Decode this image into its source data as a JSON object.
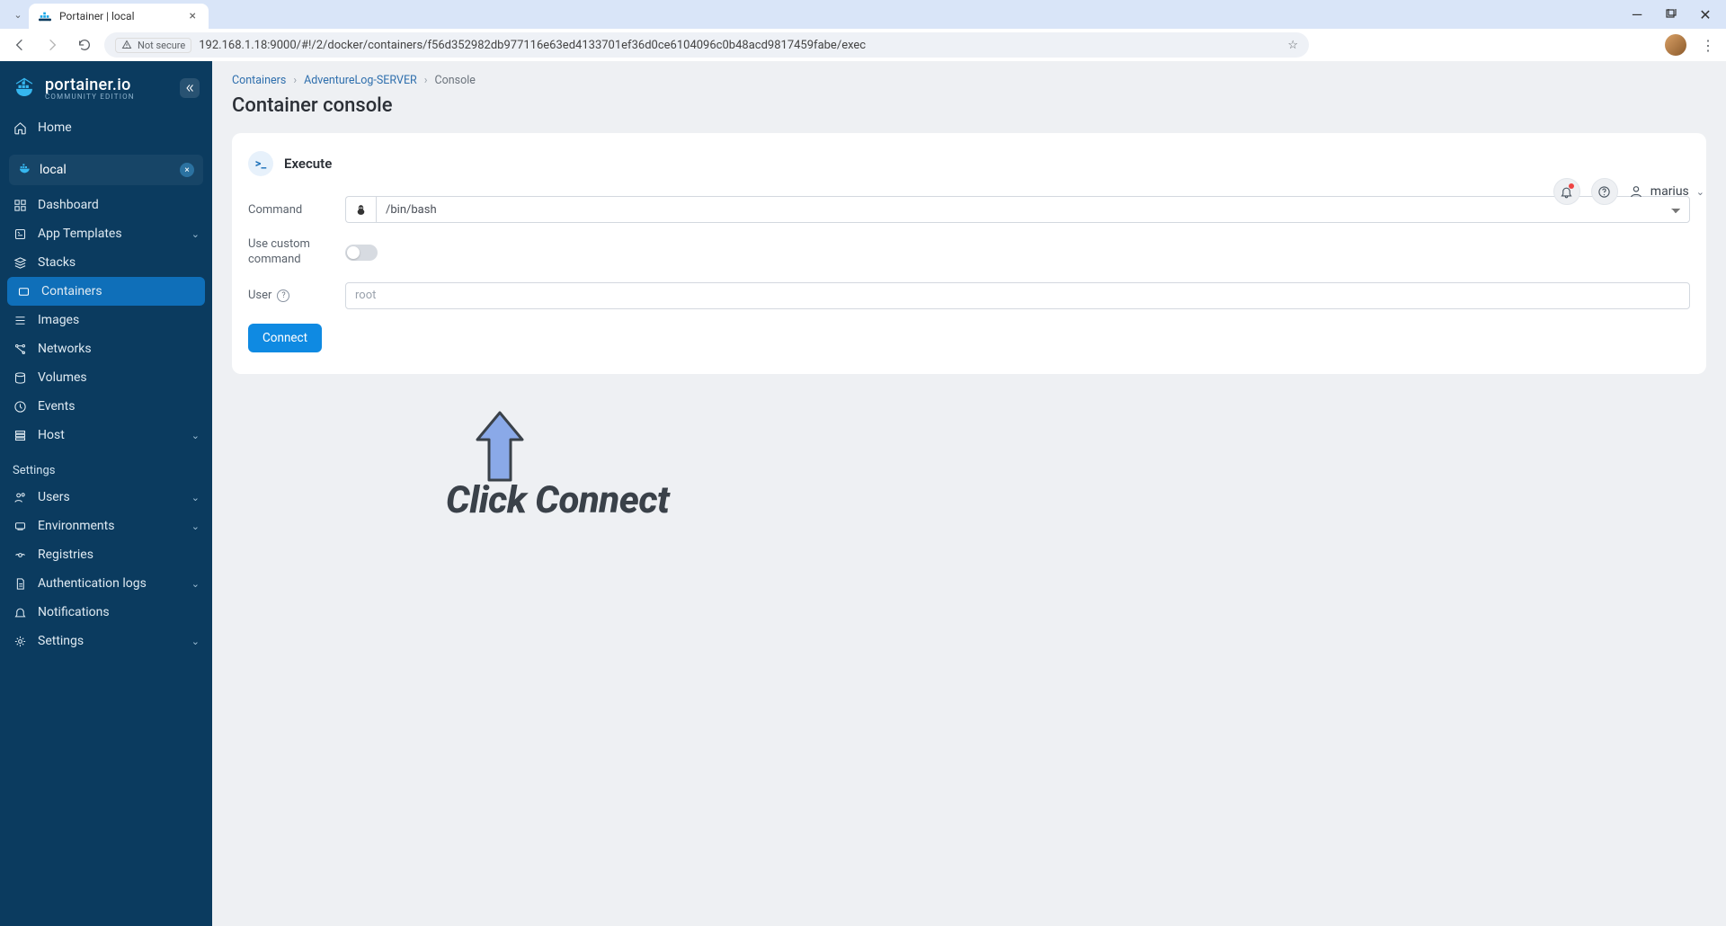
{
  "browser": {
    "tab_title": "Portainer | local",
    "security_label": "Not secure",
    "url": "192.168.1.18:9000/#!/2/docker/containers/f56d352982db977116e63ed4133701ef36d0ce6104096c0b48acd9817459fabe/exec"
  },
  "logo": {
    "name": "portainer.io",
    "sub": "COMMUNITY EDITION"
  },
  "sidebar": {
    "home": "Home",
    "env_name": "local",
    "items": [
      {
        "label": "Dashboard"
      },
      {
        "label": "App Templates",
        "chev": true
      },
      {
        "label": "Stacks"
      },
      {
        "label": "Containers",
        "active": true
      },
      {
        "label": "Images"
      },
      {
        "label": "Networks"
      },
      {
        "label": "Volumes"
      },
      {
        "label": "Events"
      },
      {
        "label": "Host",
        "chev": true
      }
    ],
    "settings_label": "Settings",
    "settings_items": [
      {
        "label": "Users",
        "chev": true
      },
      {
        "label": "Environments",
        "chev": true
      },
      {
        "label": "Registries"
      },
      {
        "label": "Authentication logs",
        "chev": true
      },
      {
        "label": "Notifications"
      },
      {
        "label": "Settings",
        "chev": true
      }
    ]
  },
  "breadcrumb": {
    "a": "Containers",
    "b": "AdventureLog-SERVER",
    "c": "Console"
  },
  "page_title": "Container console",
  "user_name": "marius",
  "card": {
    "title": "Execute",
    "icon_text": ">_",
    "command_label": "Command",
    "command_value": "/bin/bash",
    "custom_label_1": "Use custom",
    "custom_label_2": "command",
    "user_label": "User",
    "user_placeholder": "root",
    "connect": "Connect"
  },
  "annotation": "Click Connect"
}
